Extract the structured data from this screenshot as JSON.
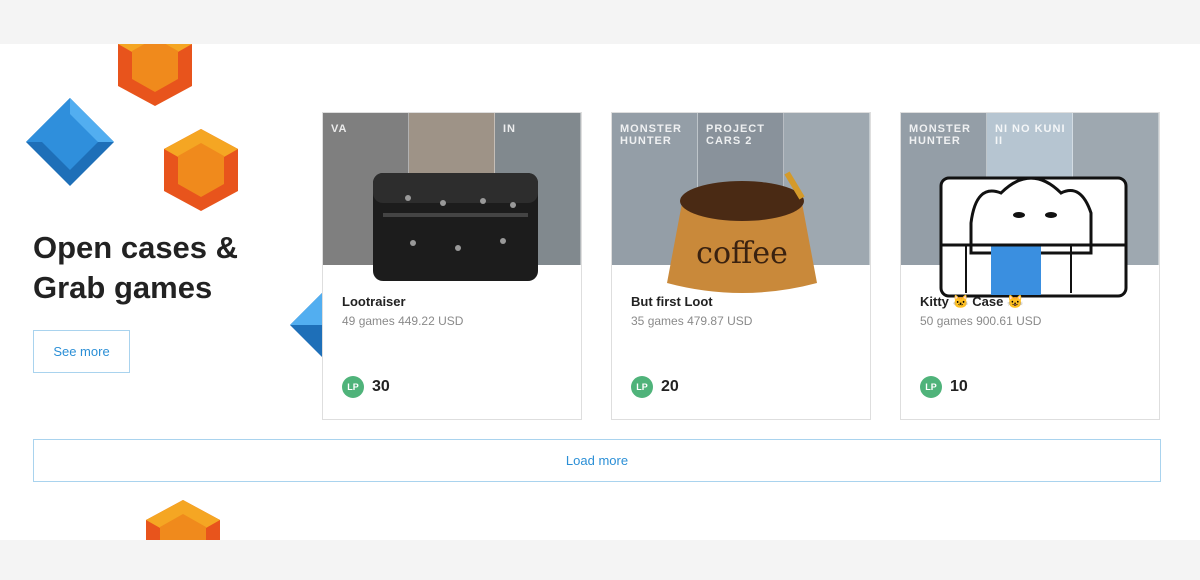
{
  "hero": {
    "title_line1": "Open cases &",
    "title_line2": "Grab games",
    "see_more_label": "See more"
  },
  "cards": [
    {
      "name": "Lootraiser",
      "games_count": "49",
      "games_word": "games",
      "total": "449.22 USD",
      "currency_icon": "LP",
      "price": "30",
      "banner_tiles": [
        "VA",
        "",
        "IN"
      ]
    },
    {
      "name": "But first Loot",
      "games_count": "35",
      "games_word": "games",
      "total": "479.87 USD",
      "currency_icon": "LP",
      "price": "20",
      "banner_tiles": [
        "MONSTER HUNTER",
        "PROJECT CARS 2",
        ""
      ],
      "case_label": "coffee"
    },
    {
      "name": "Kitty 🐱 Case 😺",
      "games_count": "50",
      "games_word": "games",
      "total": "900.61 USD",
      "currency_icon": "LP",
      "price": "10",
      "banner_tiles": [
        "MONSTER HUNTER",
        "NI NO KUNI II",
        ""
      ]
    }
  ],
  "load_more_label": "Load more",
  "colors": {
    "accent_blue": "#2b8fd6",
    "border_blue": "#a9d3ee",
    "lp_green": "#4fb37a",
    "gem_orange": "#f08a1c",
    "gem_blue": "#2f8fdc"
  }
}
